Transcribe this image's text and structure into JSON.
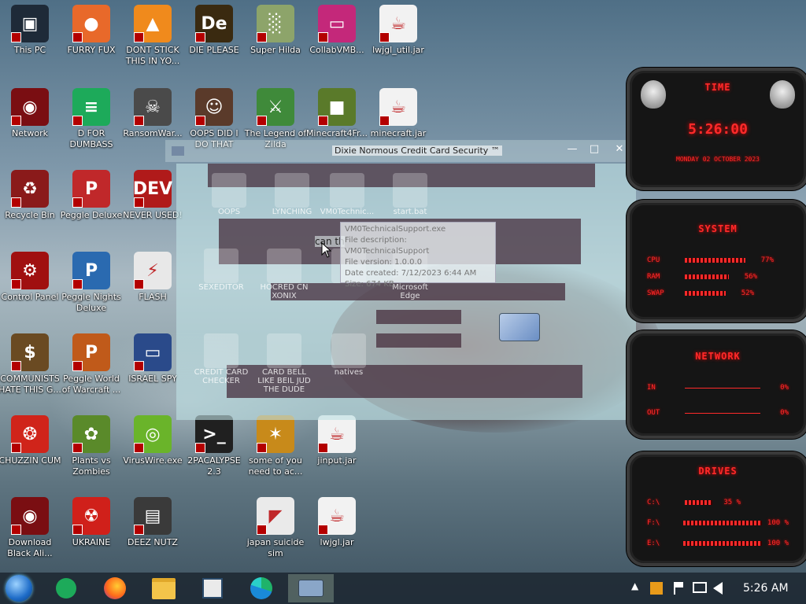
{
  "desktop": {
    "icons": [
      {
        "label": "This PC",
        "color": "#1e2a38",
        "glyph": "▣"
      },
      {
        "label": "FURRY FUX",
        "color": "#e8692a",
        "glyph": "●"
      },
      {
        "label": "DONT STICK THIS IN YO...",
        "color": "#f08a1c",
        "glyph": "▲"
      },
      {
        "label": "DIE PLEASE",
        "color": "#3a2a10",
        "glyph": "De"
      },
      {
        "label": "Super Hilda",
        "color": "#8da46a",
        "glyph": "░"
      },
      {
        "label": "CollabVMB...",
        "color": "#c4287a",
        "glyph": "▭"
      },
      {
        "label": "lwjgl_util.jar",
        "color": "#f2f2f2",
        "glyph": "☕"
      },
      {
        "label": "Network",
        "color": "#7a0e12",
        "glyph": "◉"
      },
      {
        "label": "D FOR DUMBASS",
        "color": "#1daa5a",
        "glyph": "≡"
      },
      {
        "label": "RansomWar...",
        "color": "#4a4a4a",
        "glyph": "☠"
      },
      {
        "label": "OOPS DID I DO THAT",
        "color": "#5a3a2a",
        "glyph": "☺"
      },
      {
        "label": "The Legend of Zilda",
        "color": "#3f8a3a",
        "glyph": "⚔"
      },
      {
        "label": "Minecraft4Fr...",
        "color": "#5a7a2a",
        "glyph": "■"
      },
      {
        "label": "minecraft.jar",
        "color": "#f2f2f2",
        "glyph": "☕"
      },
      {
        "label": "Recycle Bin",
        "color": "#8a1a1a",
        "glyph": "♻"
      },
      {
        "label": "Peggle Deluxe",
        "color": "#c0282a",
        "glyph": "P"
      },
      {
        "label": "NEVER USED!",
        "color": "#b01a1a",
        "glyph": "DEV"
      },
      {
        "label": "Control Panel",
        "color": "#a01010",
        "glyph": "⚙"
      },
      {
        "label": "Peggle Nights Deluxe",
        "color": "#2a6ab0",
        "glyph": "P"
      },
      {
        "label": "FLASH",
        "color": "#e8e8e8",
        "glyph": "⚡"
      },
      {
        "label": "COMMUNISTS HATE THIS G...",
        "color": "#6a4a22",
        "glyph": "$"
      },
      {
        "label": "Peggle World of Warcraft ...",
        "color": "#c05a1a",
        "glyph": "P"
      },
      {
        "label": "ISRAEL SPY",
        "color": "#2a4a8a",
        "glyph": "▭"
      },
      {
        "label": "CHUZZIN CUM",
        "color": "#d0241a",
        "glyph": "❂"
      },
      {
        "label": "Plants vs Zombies",
        "color": "#5a8a2a",
        "glyph": "✿"
      },
      {
        "label": "VirusWire.exe",
        "color": "#6ab42a",
        "glyph": "◎"
      },
      {
        "label": "2PACALYPSE 2.3",
        "color": "#202020",
        "glyph": ">_"
      },
      {
        "label": "some of you need to ac...",
        "color": "#c88a1a",
        "glyph": "✶"
      },
      {
        "label": "jinput.jar",
        "color": "#f2f2f2",
        "glyph": "☕"
      },
      {
        "label": "Download Black Ali...",
        "color": "#7a0e12",
        "glyph": "◉"
      },
      {
        "label": "UKRAINE",
        "color": "#d0201a",
        "glyph": "☢"
      },
      {
        "label": "DEEZ NUTZ",
        "color": "#3a3a3a",
        "glyph": "▤"
      },
      {
        "label": "japan suicide sim",
        "color": "#eaeaea",
        "glyph": "◤"
      },
      {
        "label": "lwjgl.jar",
        "color": "#f2f2f2",
        "glyph": "☕"
      }
    ]
  },
  "window": {
    "title": "Dixie Normous Credit Card Security ™",
    "min": "—",
    "max": "□",
    "close": "✕",
    "ghost_items": [
      {
        "label": "OOPS"
      },
      {
        "label": "LYNCHING"
      },
      {
        "label": "VM0Technic..."
      },
      {
        "label": "start.bat"
      },
      {
        "label": "SEXEDITOR"
      },
      {
        "label": "HOCRED CN XONIX"
      },
      {
        "label": ""
      },
      {
        "label": "Microsoft Edge"
      },
      {
        "label": "CREDIT CARD CHECKER"
      },
      {
        "label": "CARD BELL LIKE BEIL JUD THE DUDE"
      },
      {
        "label": "natives"
      }
    ],
    "fragment": "can th"
  },
  "tooltip": {
    "name": "VM0TechnicalSupport.exe",
    "desc": "File description: VM0TechnicalSupport",
    "version": "File version: 1.0.0.0",
    "created": "Date created: 7/12/2023 6:44 AM",
    "size": "Size: 674 KB"
  },
  "gadgets": {
    "time": {
      "head": "TIME",
      "clock": "5:26:00",
      "date": "MONDAY 02 OCTOBER 2023"
    },
    "system": {
      "head": "SYSTEM",
      "rows": [
        {
          "label": "CPU",
          "value": "77%",
          "level": 0.77
        },
        {
          "label": "RAM",
          "value": "56%",
          "level": 0.56
        },
        {
          "label": "SWAP",
          "value": "52%",
          "level": 0.52
        }
      ]
    },
    "network": {
      "head": "NETWORK",
      "rows": [
        {
          "label": "IN",
          "value": "0%"
        },
        {
          "label": "OUT",
          "value": "0%"
        }
      ]
    },
    "drives": {
      "head": "DRIVES",
      "rows": [
        {
          "label": "C:\\",
          "value": "35 %",
          "level": 0.35
        },
        {
          "label": "F:\\",
          "value": "100 %",
          "level": 1.0
        },
        {
          "label": "E:\\",
          "value": "100 %",
          "level": 1.0
        }
      ]
    }
  },
  "taskbar": {
    "apps": [
      {
        "name": "start"
      },
      {
        "name": "d-for-dumbass"
      },
      {
        "name": "firefox"
      },
      {
        "name": "file-explorer"
      },
      {
        "name": "notepad"
      },
      {
        "name": "edge"
      },
      {
        "name": "credit-card-app"
      }
    ],
    "clock": "5:26 AM",
    "tray_chevron": "▲"
  }
}
